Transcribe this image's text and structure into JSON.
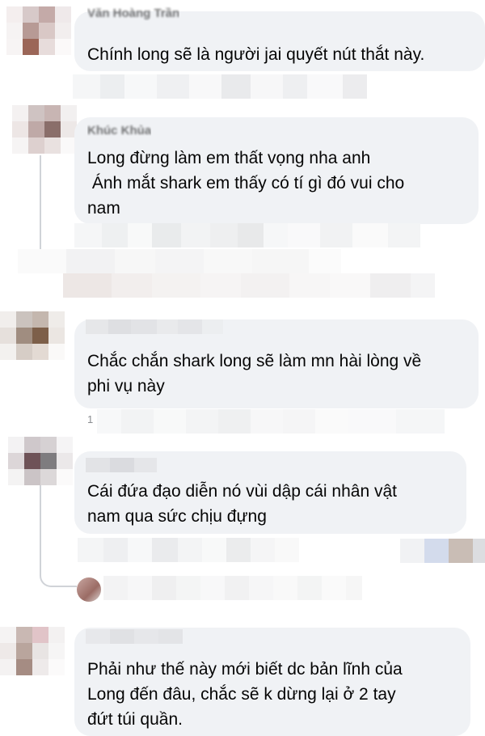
{
  "comments": [
    {
      "author": "Văn Hoàng Trần",
      "text": "Chính long sẽ là người jai quyết nút thắt này."
    },
    {
      "author": "Khúc Khủa",
      "text": "Long đừng làm em thất vọng nha anh\n Ánh mắt shark em thấy có tí gì đó vui cho\nnam"
    },
    {
      "author": "",
      "text": "Chắc chắn shark long sẽ làm mn hài lòng về\nphi vụ này"
    },
    {
      "author": "",
      "text": "Cái đứa đạo diễn nó vùi dập cái nhân vật\nnam qua sức chịu đựng"
    },
    {
      "author": "",
      "text": "Phải như thế này mới biết dc bản lĩnh của\nLong đến đâu, chắc sẽ k dừng lại ở 2 tay\nđứt túi quần."
    }
  ],
  "partial_digit": "1",
  "colors": {
    "bubble": "#f0f2f5",
    "text": "#050505",
    "thread_line": "#d0d3d8"
  }
}
